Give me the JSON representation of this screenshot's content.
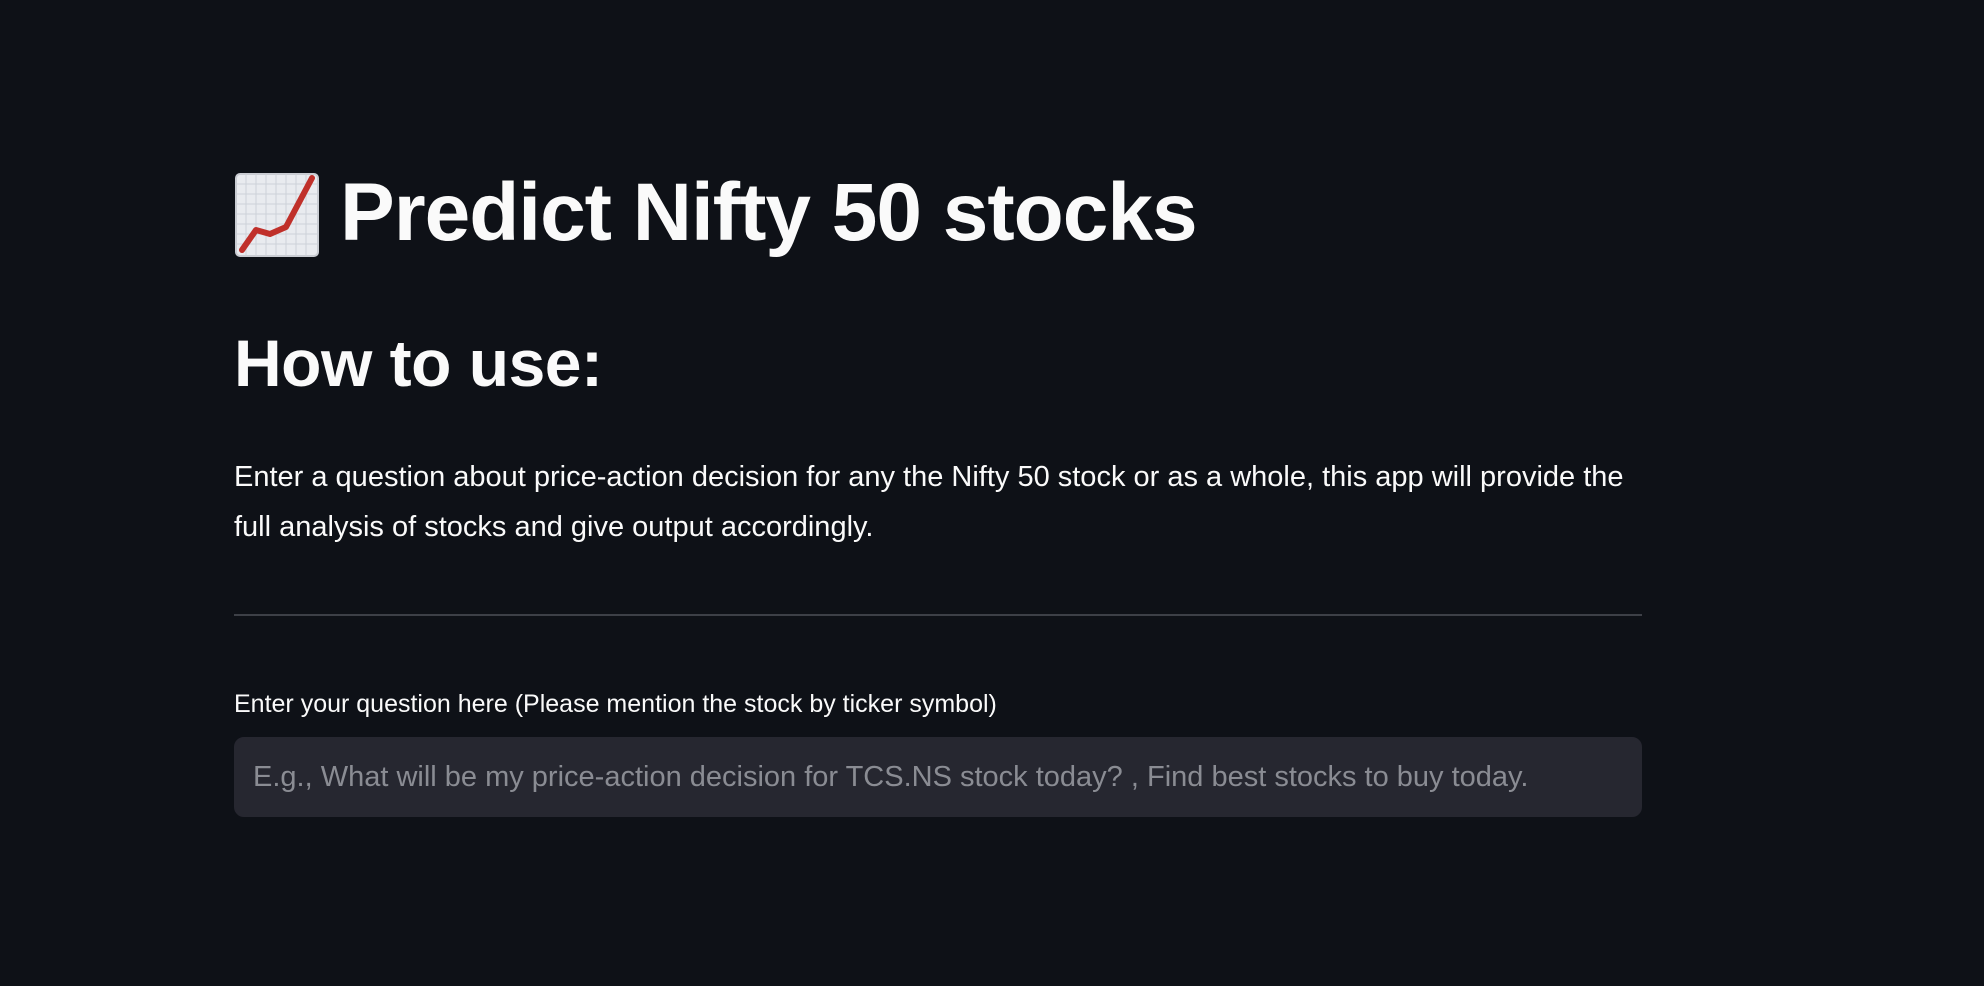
{
  "header": {
    "icon": "chart-increasing-icon",
    "title": "Predict Nifty 50 stocks"
  },
  "instructions": {
    "heading": "How to use:",
    "body": "Enter a question about price-action decision for any the Nifty 50 stock or as a whole, this app will provide the full analysis of stocks and give output accordingly."
  },
  "question_input": {
    "label": "Enter your question here (Please mention the stock by ticker symbol)",
    "value": "",
    "placeholder": "E.g., What will be my price-action decision for TCS.NS stock today? , Find best stocks to buy today."
  },
  "colors": {
    "background": "#0e1117",
    "text": "#fafafa",
    "input_background": "#262730",
    "placeholder": "#8a8c93",
    "divider": "#3d4047",
    "chart_line": "#c0302a"
  }
}
